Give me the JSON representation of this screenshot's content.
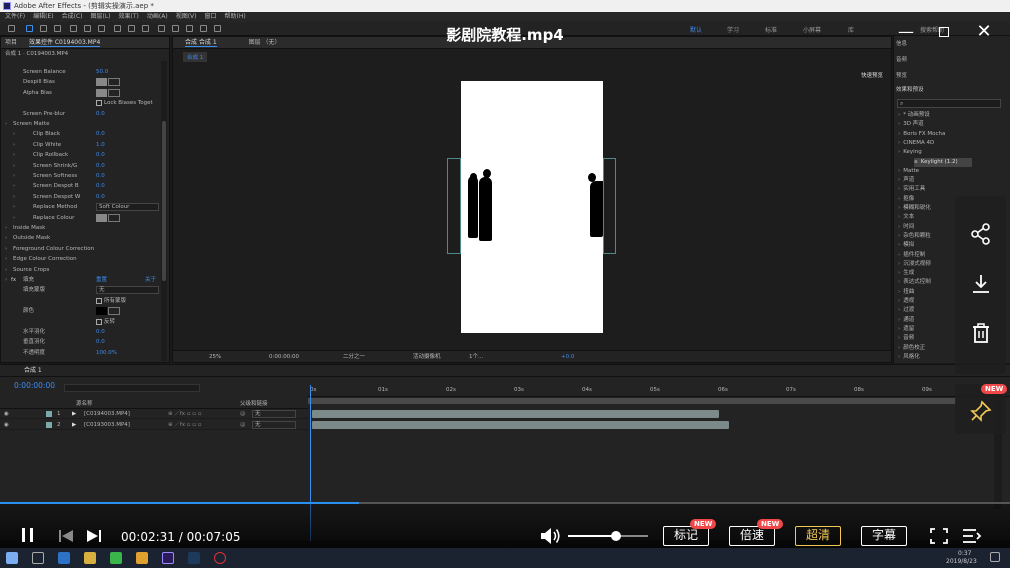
{
  "app": {
    "title": "Adobe After Effects - (剪辑实操演示.aep *",
    "menu": [
      "文件(F)",
      "编辑(E)",
      "合成(C)",
      "图层(L)",
      "效果(T)",
      "动画(A)",
      "视图(V)",
      "窗口",
      "帮助(H)"
    ],
    "workspaces": [
      "默认",
      "学习",
      "标准",
      "小屏幕",
      "库"
    ],
    "search_help": "搜索帮助"
  },
  "effects_panel": {
    "tab_project": "项目",
    "tab_effects": "效果控件 C0194003.MP4",
    "breadcrumb": "合成 1 · C0194003.MP4",
    "rows": [
      {
        "label": "Screen Balance",
        "value": "50.0",
        "indent": 1,
        "kind": "value"
      },
      {
        "label": "Despill Bias",
        "value": "",
        "indent": 1,
        "kind": "swatch"
      },
      {
        "label": "Alpha Bias",
        "value": "",
        "indent": 1,
        "kind": "swatch"
      },
      {
        "label": "Lock Biases Toget",
        "value": "",
        "indent": 1,
        "kind": "check"
      },
      {
        "label": "Screen Pre-blur",
        "value": "0.0",
        "indent": 1,
        "kind": "value"
      },
      {
        "label": "Screen Matte",
        "value": "",
        "indent": 0,
        "kind": "group"
      },
      {
        "label": "Clip Black",
        "value": "0.0",
        "indent": 2,
        "kind": "value"
      },
      {
        "label": "Clip White",
        "value": "1.0",
        "indent": 2,
        "kind": "value"
      },
      {
        "label": "Clip Rollback",
        "value": "0.0",
        "indent": 2,
        "kind": "value"
      },
      {
        "label": "Screen Shrink/G",
        "value": "0.0",
        "indent": 2,
        "kind": "value"
      },
      {
        "label": "Screen Softness",
        "value": "0.0",
        "indent": 2,
        "kind": "value"
      },
      {
        "label": "Screen Despot B",
        "value": "0.0",
        "indent": 2,
        "kind": "value"
      },
      {
        "label": "Screen Despot W",
        "value": "0.0",
        "indent": 2,
        "kind": "value"
      },
      {
        "label": "Replace Method",
        "value": "Soft Colour",
        "indent": 2,
        "kind": "drop"
      },
      {
        "label": "Replace Colour",
        "value": "",
        "indent": 2,
        "kind": "swatch"
      },
      {
        "label": "Inside Mask",
        "value": "",
        "indent": 0,
        "kind": "group"
      },
      {
        "label": "Outside Mask",
        "value": "",
        "indent": 0,
        "kind": "group"
      },
      {
        "label": "Foreground Colour Correction",
        "value": "",
        "indent": 0,
        "kind": "group"
      },
      {
        "label": "Edge Colour Correction",
        "value": "",
        "indent": 0,
        "kind": "group"
      },
      {
        "label": "Source Crops",
        "value": "",
        "indent": 0,
        "kind": "group"
      },
      {
        "label": "填充",
        "value": "重置",
        "indent": 0,
        "kind": "fx"
      },
      {
        "label": "填充蒙版",
        "value": "无",
        "indent": 1,
        "kind": "drop"
      },
      {
        "label": "",
        "value": "所有蒙版",
        "indent": 1,
        "kind": "check"
      },
      {
        "label": "颜色",
        "value": "",
        "indent": 1,
        "kind": "black"
      },
      {
        "label": "",
        "value": "反转",
        "indent": 1,
        "kind": "check"
      },
      {
        "label": "水平羽化",
        "value": "0.0",
        "indent": 1,
        "kind": "value"
      },
      {
        "label": "垂直羽化",
        "value": "0.0",
        "indent": 1,
        "kind": "value"
      },
      {
        "label": "不透明度",
        "value": "100.0%",
        "indent": 1,
        "kind": "value"
      }
    ],
    "about": "关于"
  },
  "viewer": {
    "tab_comp": "合成 合成 1",
    "tab_layer": "图层 （无）",
    "comp_chip": "合成 1",
    "fast_preview": "快速预览",
    "zoom": "25%",
    "timecode": "0:00:00:00",
    "resolution": "二分之一",
    "camera": "活动摄像机",
    "views": "1个...",
    "exposure": "+0.0"
  },
  "right_panel": {
    "items": [
      "信息",
      "音频",
      "预览"
    ],
    "effects_title": "效果和预设",
    "effects_list": [
      "* 动画预设",
      "3D 声道",
      "Boris FX Mocha",
      "CINEMA 4D",
      "Keying",
      "Keylight (1.2)",
      "Matte",
      "声道",
      "实用工具",
      "抠像",
      "模糊和锐化",
      "文本",
      "时间",
      "杂色和颗粒",
      "模拟",
      "插件控制",
      "沉浸式视频",
      "生成",
      "表达式控制",
      "扭曲",
      "透视",
      "过渡",
      "通道",
      "遗留",
      "音频",
      "颜色校正",
      "风格化"
    ]
  },
  "timeline": {
    "tab": "合成 1",
    "timecode": "0:00:00:00",
    "col_source": "源名称",
    "col_parent": "父级和链接",
    "ruler": [
      "0s",
      "01s",
      "02s",
      "03s",
      "04s",
      "05s",
      "06s",
      "07s",
      "08s",
      "09s"
    ],
    "layers": [
      {
        "num": "1",
        "name": "[C0194003.MP4]",
        "parent": "无",
        "track_end": 0.585
      },
      {
        "num": "2",
        "name": "[C0193003.MP4]",
        "parent": "无",
        "track_end": 0.6
      }
    ]
  },
  "taskbar": {
    "time": "0:37",
    "date": "2019/8/23"
  },
  "player": {
    "video_title": "影剧院教程.mp4",
    "current_time": "00:02:31",
    "duration": "00:07:05",
    "progress": 0.355,
    "volume": 0.6,
    "btn_mark": "标记",
    "btn_speed": "倍速",
    "btn_hd": "超清",
    "btn_subtitle": "字幕",
    "badge_new": "NEW",
    "accent": "#f3c955",
    "progress_color": "#2b8ff0"
  }
}
